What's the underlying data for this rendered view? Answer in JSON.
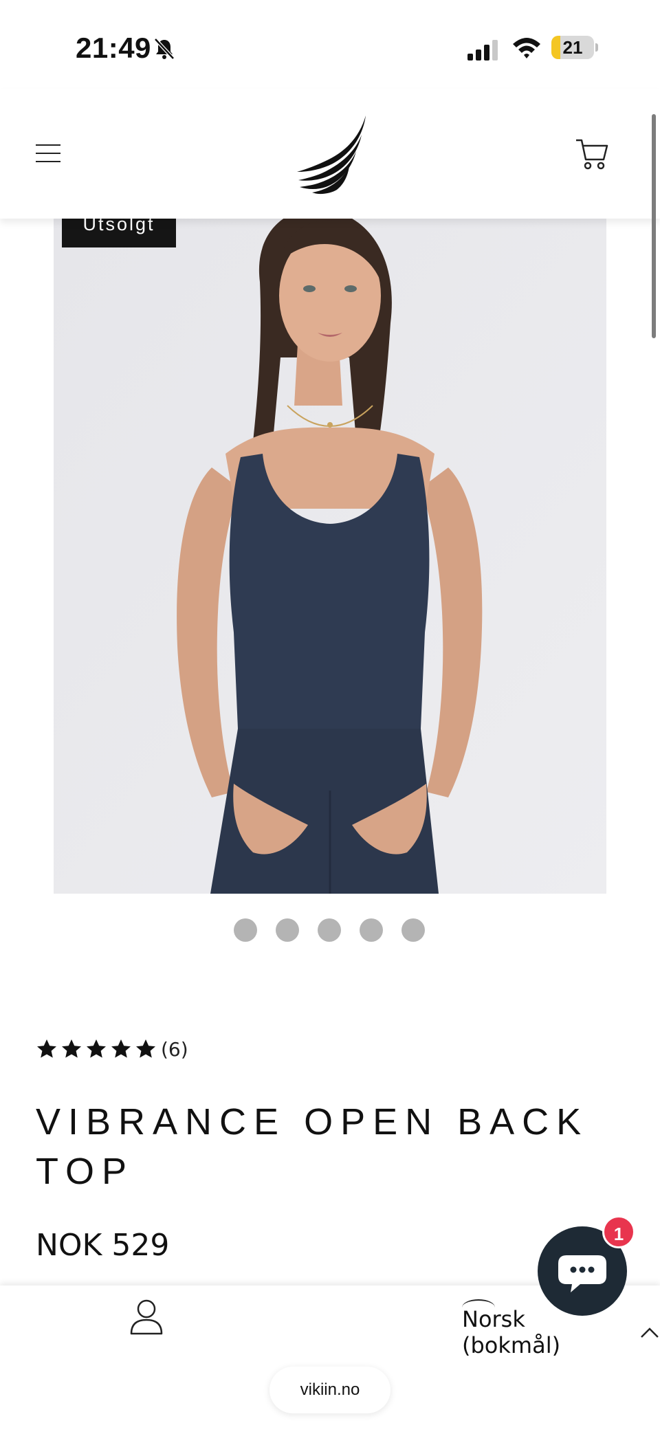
{
  "status_bar": {
    "time": "21:49",
    "battery_level": "21",
    "battery_fraction": 0.21,
    "icons": [
      "bell-slash-icon",
      "cellular-signal-icon",
      "wifi-icon",
      "battery-icon"
    ]
  },
  "header": {
    "icons": [
      "hamburger-menu-icon",
      "wing-logo",
      "shopping-cart-icon"
    ]
  },
  "product": {
    "badge": "Utsolgt",
    "image_count": 5,
    "active_image": 1,
    "rating": {
      "stars": 5,
      "count": "(6)"
    },
    "title": "VIBRANCE OPEN BACK TOP",
    "price": "NOK 529"
  },
  "chat": {
    "badge_count": "1",
    "icon": "chat-bubble-icon"
  },
  "bottom_bar": {
    "language": "Norsk (bokmål)",
    "url": "vikiin.no",
    "icons": [
      "account-icon",
      "chevron-up-icon"
    ]
  },
  "colors": {
    "badge_bg": "#151515",
    "chat_bg": "#1e2a35",
    "notification": "#e8354e",
    "battery": "#f4c623",
    "top_color": "#2f3b52"
  }
}
